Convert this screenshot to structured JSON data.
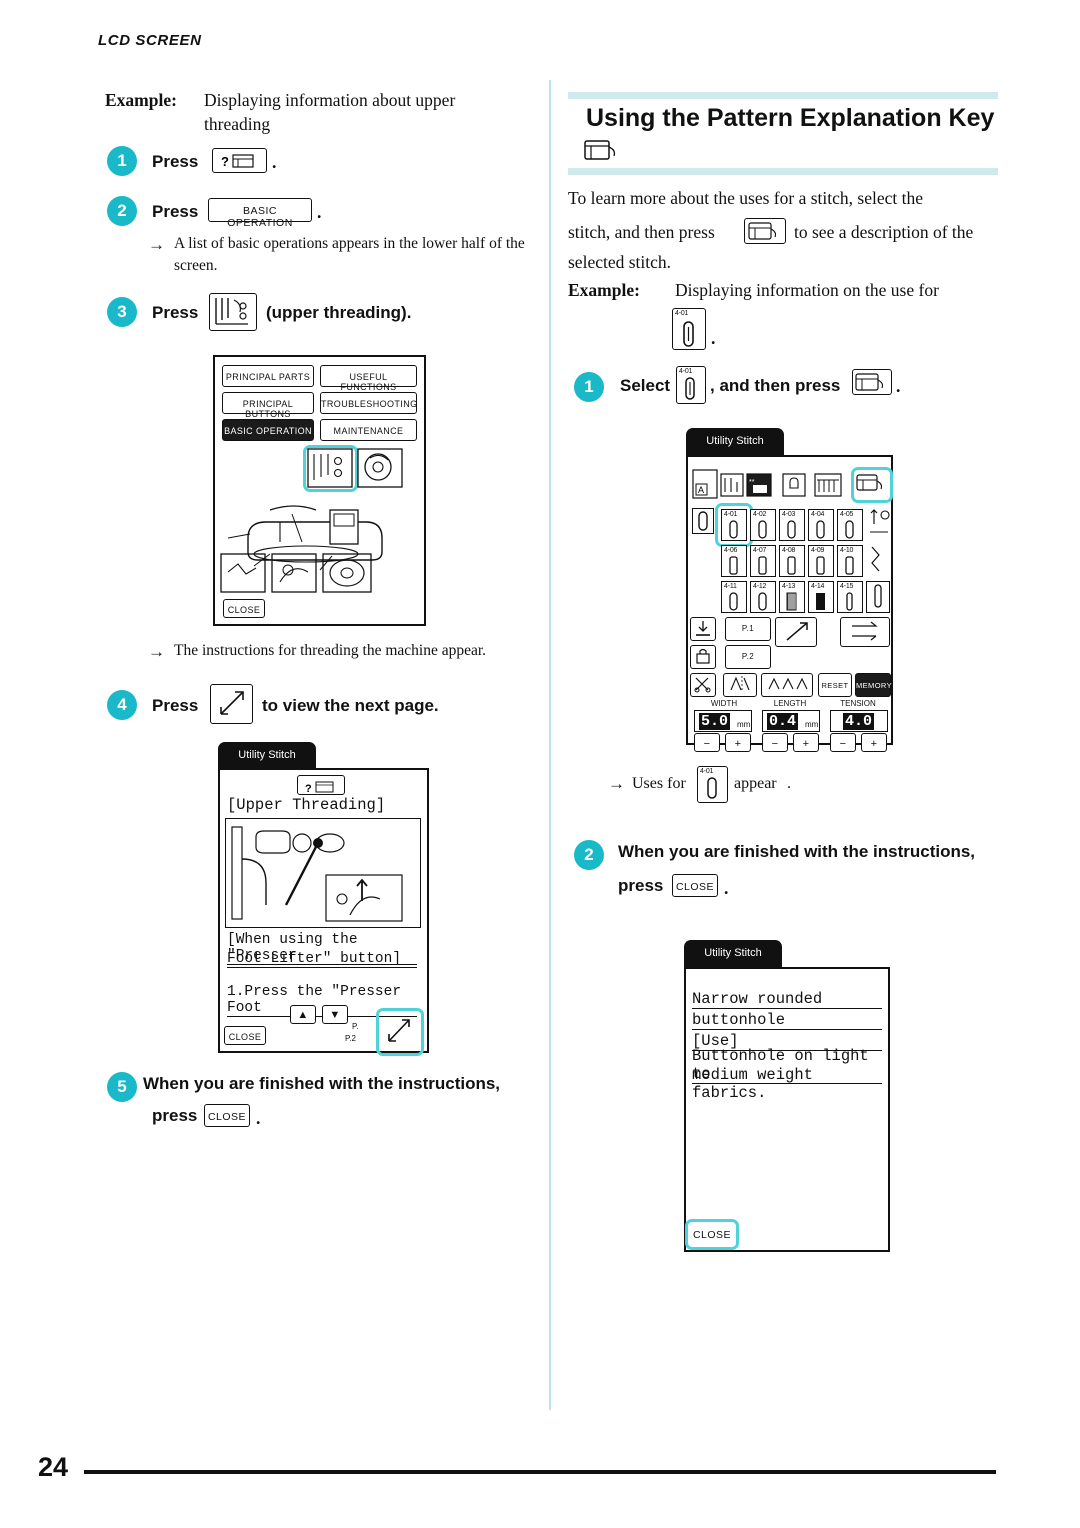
{
  "header": {
    "running_head": "LCD SCREEN",
    "page_number": "24"
  },
  "left": {
    "example_label": "Example:",
    "example_text_line1": "Displaying information about upper",
    "example_text_line2": "threading",
    "step1": {
      "num": "1",
      "press": "Press",
      "key": "help-icon",
      "period": "."
    },
    "step2": {
      "num": "2",
      "press": "Press",
      "key_label": "BASIC OPERATION",
      "period": "."
    },
    "step2_result": "A list of basic operations appears in the lower half of the screen.",
    "step3": {
      "num": "3",
      "press": "Press",
      "key": "upper-threading-icon",
      "tail": "(upper threading)."
    },
    "screen1": {
      "buttons": [
        "PRINCIPAL PARTS",
        "USEFUL FUNCTIONS",
        "PRINCIPAL BUTTONS",
        "TROUBLESHOOTING",
        "BASIC OPERATION",
        "MAINTENANCE"
      ],
      "selected": "BASIC OPERATION",
      "close": "CLOSE"
    },
    "step3_result": "The instructions for threading the machine appear.",
    "step4": {
      "num": "4",
      "press": "Press",
      "tail": "to view the next page."
    },
    "screen2": {
      "tab": "Utility Stitch",
      "title": "[Upper Threading]",
      "line1": "[When using the \"Presser",
      "line2": "Foot Lifter\" button]",
      "line3": "1.Press the \"Presser Foot",
      "close": "CLOSE",
      "page_label_1": "P.",
      "page_label_2": "P.2"
    },
    "step5": {
      "num": "5",
      "text1": "When you are finished with the instructions,",
      "text2": "press",
      "key_label": "CLOSE",
      "period": "."
    }
  },
  "right": {
    "title": "Using the Pattern Explanation Key",
    "title_icon": "pattern-explanation-icon",
    "intro_l1": "To learn more about the uses for a stitch, select the",
    "intro_l2a": "stitch, and then press",
    "intro_l2b": "to see a description of the",
    "intro_l3": "selected stitch.",
    "example_label": "Example:",
    "example_text": "Displaying information on the use for",
    "example_stitch": "4-01",
    "example_period": ".",
    "step1": {
      "num": "1",
      "select": "Select",
      "mid": ", and then press",
      "period": ".",
      "stitch": "4-01"
    },
    "screen3": {
      "tab": "Utility Stitch",
      "stitch_rows": [
        [
          "4-01",
          "4-02",
          "4-03",
          "4-04",
          "4-05"
        ],
        [
          "4-06",
          "4-07",
          "4-08",
          "4-09",
          "4-10"
        ],
        [
          "4-11",
          "4-12",
          "4-13",
          "4-14",
          "4-15"
        ]
      ],
      "selected_stitch": "4-01",
      "page_1": "P.1",
      "page_2": "P.2",
      "reset": "RESET",
      "memory": "MEMORY",
      "width_label": "WIDTH",
      "length_label": "LENGTH",
      "tension_label": "TENSION",
      "width_value": "5.0",
      "width_unit": "mm",
      "length_value": "0.4",
      "length_unit": "mm",
      "tension_value": "4.0",
      "minus": "−",
      "plus": "+"
    },
    "step1_result_a": "Uses for",
    "step1_result_b": "appear",
    "step1_result_stitch": "4-01",
    "step2": {
      "num": "2",
      "text1": "When you are finished with the instructions,",
      "text2": "press",
      "key_label": "CLOSE",
      "period": "."
    },
    "screen4": {
      "tab": "Utility Stitch",
      "line1": "Narrow rounded",
      "line2": "buttonhole",
      "line3": "[Use]",
      "line4": "Buttonhole on light to",
      "line5": "medium weight fabrics.",
      "close": "CLOSE"
    }
  },
  "colors": {
    "accent": "#19b9c9",
    "highlight": "#4fd3d8",
    "title_bar": "#cfe9ec",
    "divider": "#bfe3e6"
  }
}
